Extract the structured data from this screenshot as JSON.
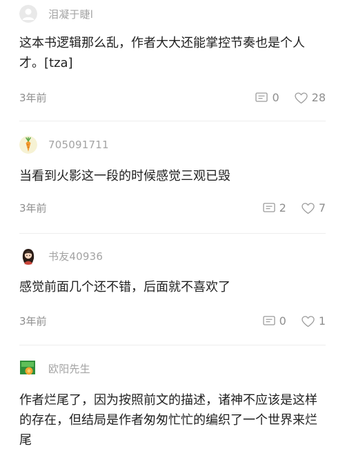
{
  "comments": [
    {
      "username": "泪凝于睫l",
      "avatar": "default-avatar-icon",
      "text": "这本书逻辑那么乱，作者大大还能掌控节奏也是个人才。[tza]",
      "time": "3年前",
      "reply_count": "0",
      "like_count": "28"
    },
    {
      "username": "705091711",
      "avatar": "carrot-avatar-icon",
      "text": "当看到火影这一段的时候感觉三观已毁",
      "time": "3年前",
      "reply_count": "2",
      "like_count": "7"
    },
    {
      "username": "书友40936",
      "avatar": "girl-avatar-icon",
      "text": "感觉前面几个还不错，后面就不喜欢了",
      "time": "3年前",
      "reply_count": "0",
      "like_count": "1"
    },
    {
      "username": "欧阳先生",
      "avatar": "green-badge-avatar-icon",
      "text": "作者烂尾了，因为按照前文的描述，诸神不应该是这样的存在，但结局是作者匆匆忙忙的编织了一个世界来烂尾"
    }
  ],
  "colors": {
    "username": "#a3a3a3",
    "body_text": "#1f1f1f",
    "meta": "#8e8e8e",
    "divider": "#ededed"
  }
}
